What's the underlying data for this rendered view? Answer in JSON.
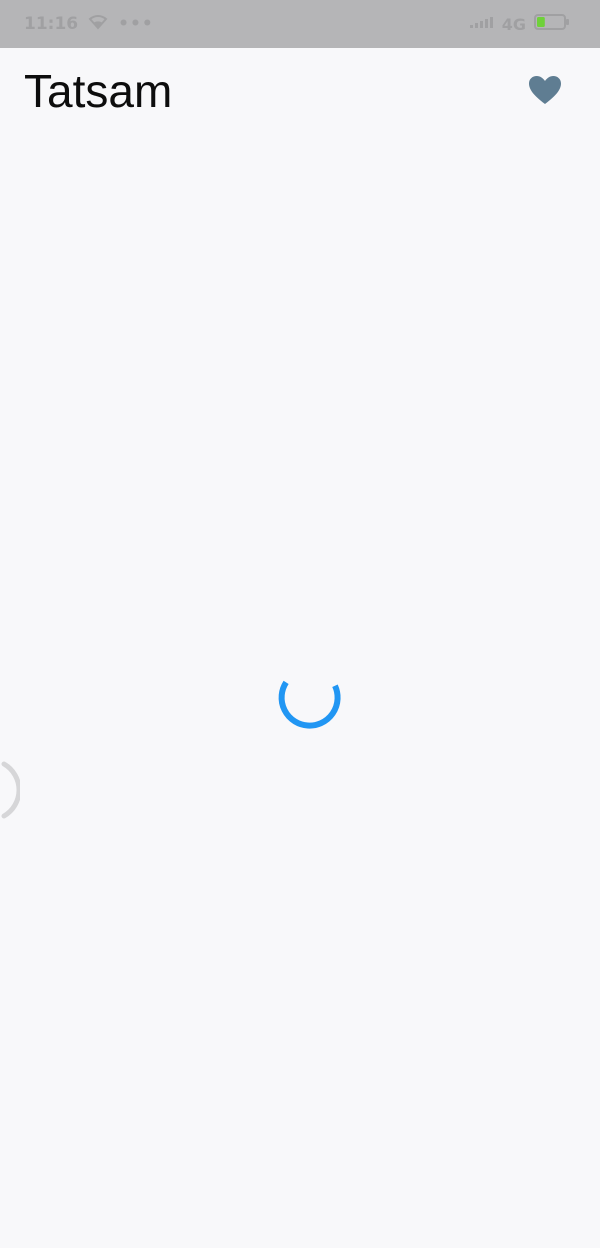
{
  "status_bar": {
    "time": "11:16",
    "overflow_dots": "•••",
    "network": "4G",
    "battery_level": 0.3
  },
  "header": {
    "title": "Tatsam",
    "favorite_icon": "heart-icon"
  },
  "main": {
    "loading_indicator": "spinner",
    "refresh_indicator": "pull-to-refresh-arc"
  },
  "colors": {
    "status_bar_bg": "#b5b5b7",
    "background": "#f8f8fa",
    "title_text": "#0d0d0d",
    "heart_icon": "#5f7d92",
    "spinner": "#2196f3",
    "battery_fill": "#6fd13a"
  }
}
